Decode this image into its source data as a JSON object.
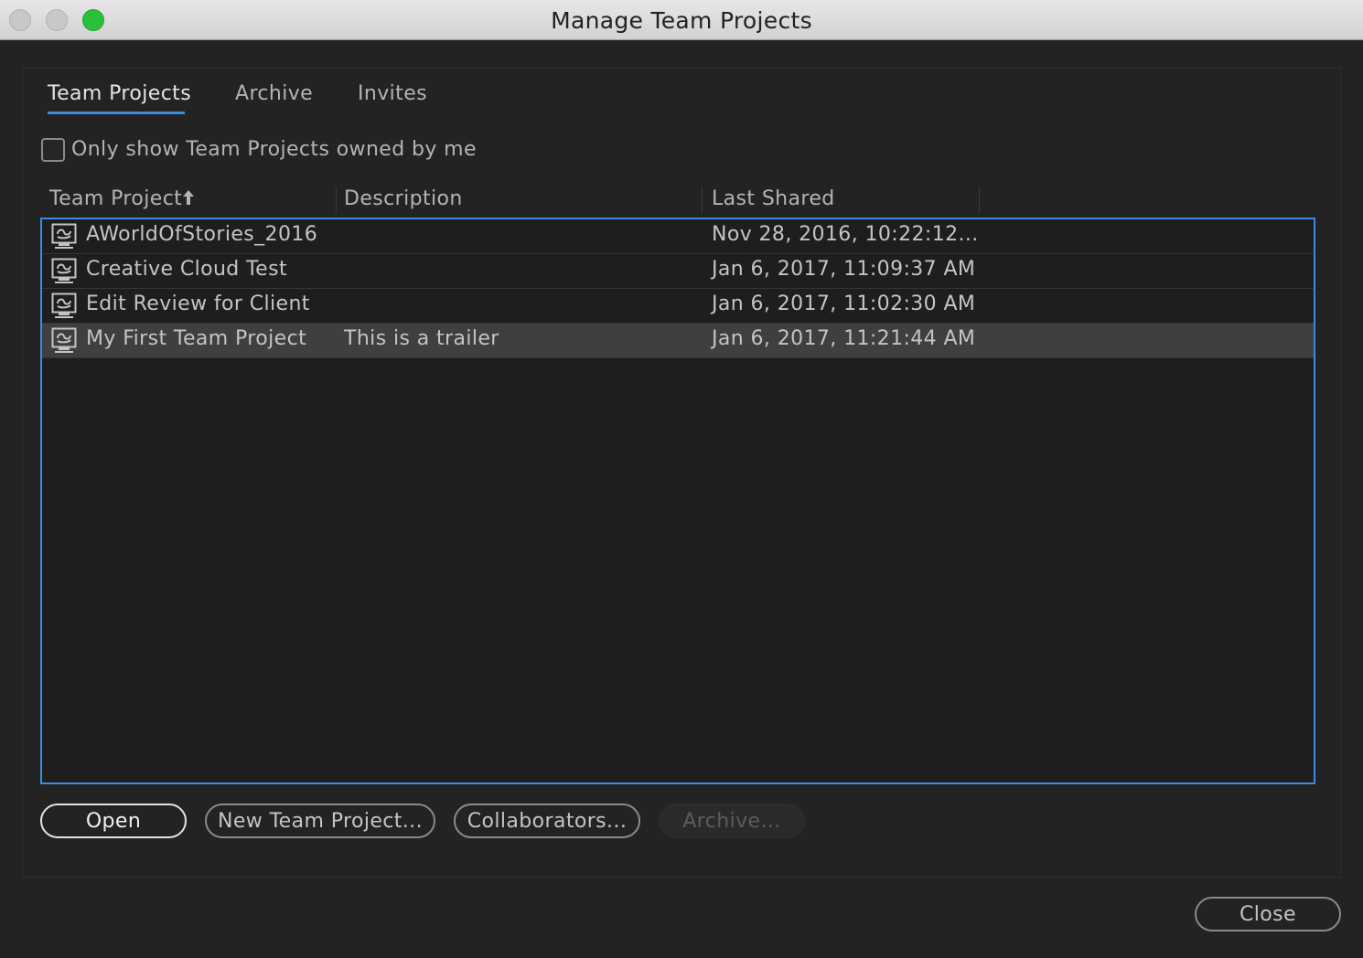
{
  "window": {
    "title": "Manage Team Projects"
  },
  "tabs": [
    {
      "label": "Team Projects",
      "active": true
    },
    {
      "label": "Archive",
      "active": false
    },
    {
      "label": "Invites",
      "active": false
    }
  ],
  "filter": {
    "label": "Only show Team Projects owned by me",
    "checked": false
  },
  "table": {
    "columns": [
      "Team Project",
      "Description",
      "Last Shared"
    ],
    "sort_column": "Team Project",
    "sort_direction": "ascending",
    "rows": [
      {
        "name": "AWorldOfStories_2016",
        "description": "",
        "last_shared": "Nov 28, 2016, 10:22:12...",
        "selected": false
      },
      {
        "name": "Creative Cloud Test",
        "description": "",
        "last_shared": "Jan 6, 2017, 11:09:37 AM",
        "selected": false
      },
      {
        "name": "Edit Review for Client",
        "description": "",
        "last_shared": "Jan 6, 2017, 11:02:30 AM",
        "selected": false
      },
      {
        "name": "My First Team Project",
        "description": "This is a trailer",
        "last_shared": "Jan 6, 2017, 11:21:44 AM",
        "selected": true
      }
    ],
    "row_icon": "team-project-icon"
  },
  "buttons": {
    "open": "Open",
    "new_team_project": "New Team Project...",
    "collaborators": "Collaborators...",
    "archive": "Archive...",
    "close": "Close"
  },
  "colors": {
    "accent": "#3b8be0",
    "background": "#232323",
    "maximize": "#29c13a"
  }
}
